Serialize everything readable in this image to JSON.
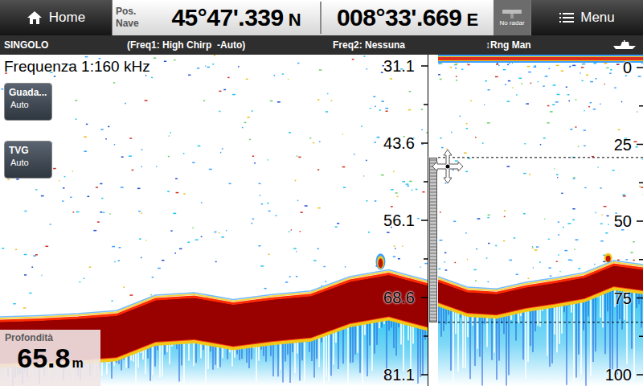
{
  "top_bar": {
    "home": {
      "label": "Home"
    },
    "position": {
      "label_line1": "Pos.",
      "label_line2": "Nave",
      "latitude": "45°47'.339",
      "lat_hemisphere": "N",
      "longitude": "008°33'.669",
      "lon_hemisphere": "E"
    },
    "radar": {
      "label": "No radar"
    },
    "menu": {
      "label": "Menu"
    }
  },
  "status_bar": {
    "mode": "SINGOLO",
    "freq1": "(Freq1: High Chirp  -Auto)",
    "freq2": "Freq2: Nessuna",
    "range": "↕Rng Man"
  },
  "sonar": {
    "frequency_label": "Frequenza 1:160 kHz",
    "controls": [
      {
        "label": "Guada...",
        "value": "Auto"
      },
      {
        "label": "TVG",
        "value": "Auto"
      }
    ],
    "depth_scale": {
      "ticks": [
        "31.1",
        "43.6",
        "56.1",
        "68.6",
        "81.1"
      ]
    },
    "bottom_profile": [
      72.5,
      72.3,
      72.0,
      71.5,
      69.0,
      68.6,
      69.7,
      68.9,
      68.3,
      66.0,
      64.9,
      66.6
    ],
    "depth_readout": {
      "label": "Profondità",
      "value": "65.8",
      "unit": "m"
    }
  },
  "zoom": {
    "depth_scale": {
      "ticks": [
        "0",
        "25",
        "50",
        "75",
        "100"
      ]
    },
    "bottom_profile": [
      69.6,
      73.0,
      73.6,
      71.5,
      70.0,
      68.3,
      64.4,
      65.7
    ]
  }
}
